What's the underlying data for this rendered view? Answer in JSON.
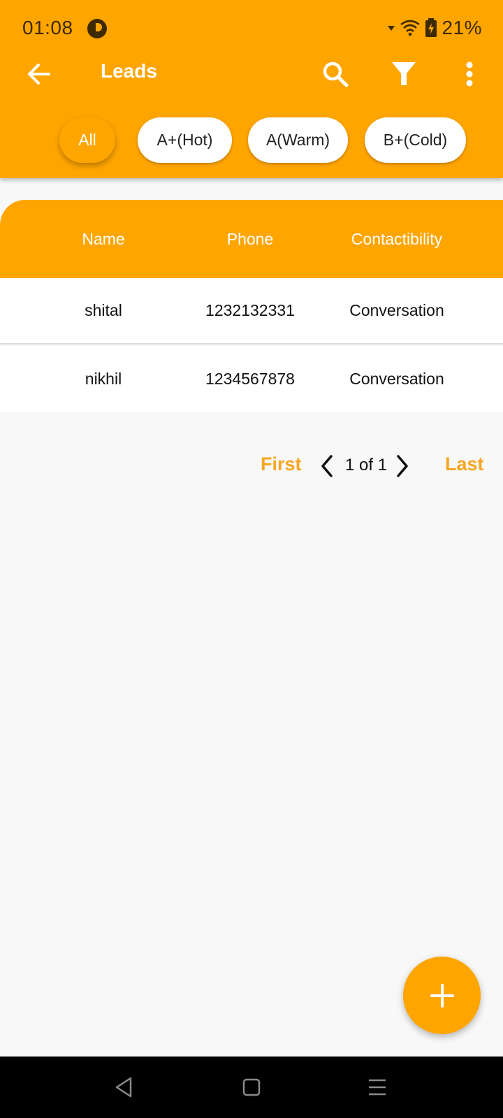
{
  "status_bar": {
    "time": "01:08",
    "battery_percent": "21%",
    "icons": [
      "app-notification-icon",
      "signal-icon",
      "wifi-icon",
      "battery-charging-icon"
    ]
  },
  "toolbar": {
    "title": "Leads",
    "icons": [
      "back-arrow-icon",
      "search-icon",
      "filter-icon",
      "more-vert-icon"
    ]
  },
  "filters": {
    "chips": [
      {
        "label": "All",
        "selected": true
      },
      {
        "label": "A+(Hot)",
        "selected": false
      },
      {
        "label": "A(Warm)",
        "selected": false
      },
      {
        "label": "B+(Cold)",
        "selected": false
      }
    ]
  },
  "table": {
    "columns": [
      "Name",
      "Phone",
      "Contactibility"
    ],
    "rows": [
      {
        "name": "shital",
        "phone": "1232132331",
        "contactibility": "Conversation"
      },
      {
        "name": "nikhil",
        "phone": "1234567878",
        "contactibility": "Conversation"
      }
    ]
  },
  "pagination": {
    "first_label": "First",
    "last_label": "Last",
    "page_info": "1 of 1"
  },
  "fab": {
    "icon": "add-icon"
  },
  "nav_bar": {
    "icons": [
      "nav-back-icon",
      "nav-home-icon",
      "nav-menu-icon"
    ]
  },
  "colors": {
    "primary": "#FFA500",
    "accent_text": "#F5A623",
    "background": "#F8F8F8",
    "nav_bar": "#000000"
  }
}
